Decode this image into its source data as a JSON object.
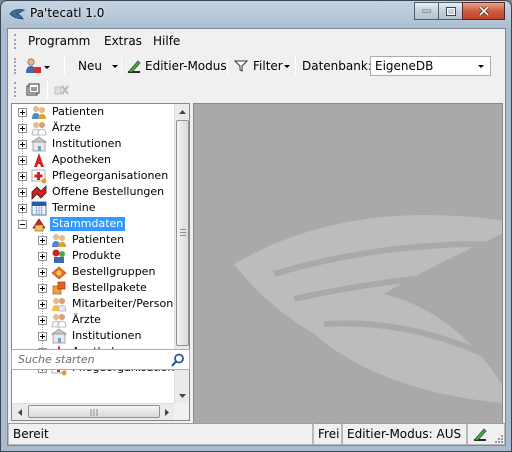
{
  "window": {
    "title": "Pa'tecatl 1.0",
    "controls": {
      "minimize": "minimize-icon",
      "maximize": "maximize-icon",
      "close": "close-icon"
    }
  },
  "menubar": {
    "items": [
      "Programm",
      "Extras",
      "Hilfe"
    ]
  },
  "toolbar": {
    "new_label": "Neu",
    "edit_mode_label": "Editier-Modus",
    "filter_label": "Filter",
    "database_label": "Datenbank:",
    "database_value": "EigeneDB"
  },
  "tree": {
    "items": [
      {
        "label": "Patienten",
        "icon": "patients-icon",
        "expanded": false
      },
      {
        "label": "Ärzte",
        "icon": "doctors-icon",
        "expanded": false
      },
      {
        "label": "Institutionen",
        "icon": "institutions-icon",
        "expanded": false
      },
      {
        "label": "Apotheken",
        "icon": "pharmacy-icon",
        "expanded": false
      },
      {
        "label": "Pflegeorganisationen",
        "icon": "care-organizations-icon",
        "expanded": false
      },
      {
        "label": "Offene Bestellungen",
        "icon": "open-orders-icon",
        "expanded": false
      },
      {
        "label": "Termine",
        "icon": "calendar-icon",
        "expanded": false
      },
      {
        "label": "Stammdaten",
        "icon": "master-data-icon",
        "expanded": true,
        "selected": true,
        "children": [
          {
            "label": "Patienten",
            "icon": "patients-icon"
          },
          {
            "label": "Produkte",
            "icon": "products-icon"
          },
          {
            "label": "Bestellgruppen",
            "icon": "order-groups-icon"
          },
          {
            "label": "Bestellpakete",
            "icon": "order-packages-icon"
          },
          {
            "label": "Mitarbeiter/Personen",
            "icon": "employees-icon"
          },
          {
            "label": "Ärzte",
            "icon": "doctors-icon"
          },
          {
            "label": "Institutionen",
            "icon": "institutions-icon"
          },
          {
            "label": "Apotheken",
            "icon": "pharmacy-icon"
          },
          {
            "label": "Pflegeorganisationen",
            "icon": "care-organizations-icon"
          }
        ]
      }
    ]
  },
  "search": {
    "placeholder": "Suche starten"
  },
  "statusbar": {
    "status": "Bereit",
    "state": "Frei",
    "edit_mode": "Editier-Modus: AUS"
  },
  "colors": {
    "selection": "#3399ff",
    "content_bg": "#a9a9a9",
    "pharmacy_red": "#d42020"
  }
}
